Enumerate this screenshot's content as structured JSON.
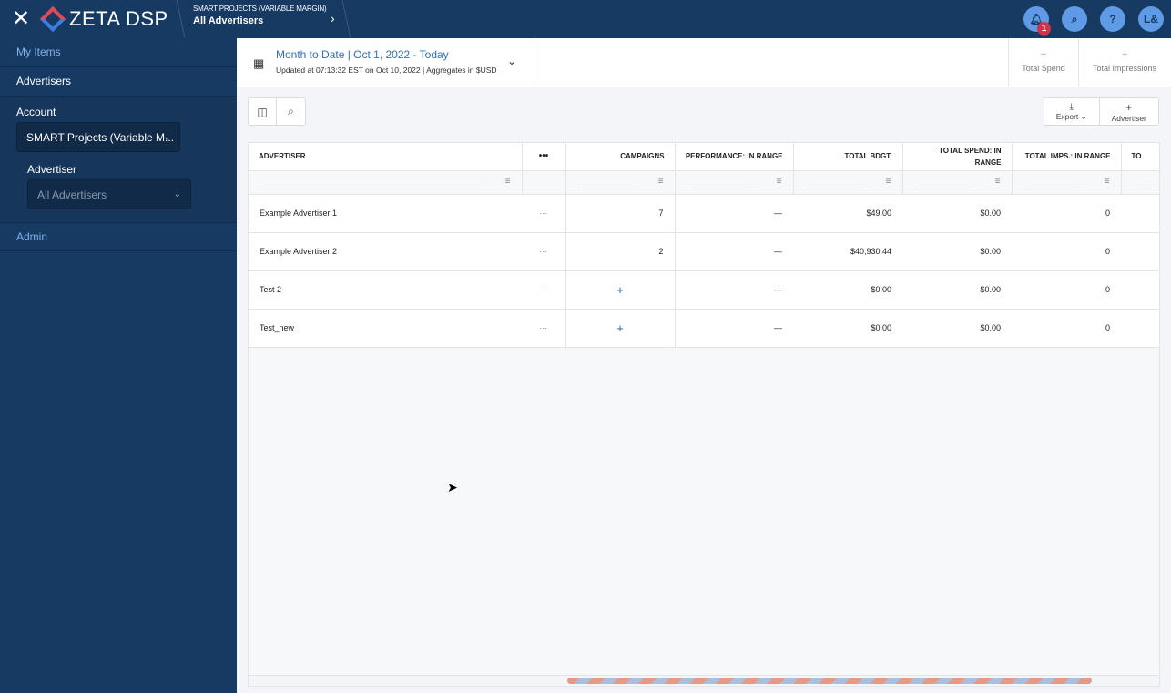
{
  "topbar": {
    "brand": "ZETA DSP",
    "crumb_small": "SMART PROJECTS (VARIABLE MARGIN)",
    "crumb_main": "All Advertisers",
    "notif_count": "1",
    "help": "?",
    "avatar": "L&"
  },
  "sidebar": {
    "my_items": "My Items",
    "advertisers": "Advertisers",
    "account_label": "Account",
    "account_value": "SMART Projects (Variable M...",
    "advertiser_label": "Advertiser",
    "advertiser_value": "All Advertisers",
    "admin": "Admin"
  },
  "header": {
    "date_range": "Month to Date | Oct 1, 2022 - Today",
    "updated": "Updated at 07:13:32 EST on Oct 10, 2022 | Aggregates in $USD",
    "stats": [
      {
        "value": "--",
        "label": "Total Spend"
      },
      {
        "value": "--",
        "label": "Total Impressions"
      }
    ]
  },
  "toolbar": {
    "export": "Export",
    "add": "Advertiser"
  },
  "table": {
    "headers": [
      "ADVERTISER",
      "•••",
      "CAMPAIGNS",
      "PERFORMANCE: IN RANGE",
      "TOTAL BDGT.",
      "TOTAL SPEND: IN RANGE",
      "TOTAL IMPS.: IN RANGE",
      "TO"
    ],
    "rows": [
      {
        "name": "Example Advertiser 1",
        "campaigns": "7",
        "perf": "—",
        "budget": "$49.00",
        "spend": "$0.00",
        "imps": "0"
      },
      {
        "name": "Example Advertiser 2",
        "campaigns": "2",
        "perf": "—",
        "budget": "$40,930.44",
        "spend": "$0.00",
        "imps": "0"
      },
      {
        "name": "Test 2",
        "campaigns": "+",
        "perf": "—",
        "budget": "$0.00",
        "spend": "$0.00",
        "imps": "0"
      },
      {
        "name": "Test_new",
        "campaigns": "+",
        "perf": "—",
        "budget": "$0.00",
        "spend": "$0.00",
        "imps": "0"
      }
    ],
    "row_menu": "···"
  }
}
